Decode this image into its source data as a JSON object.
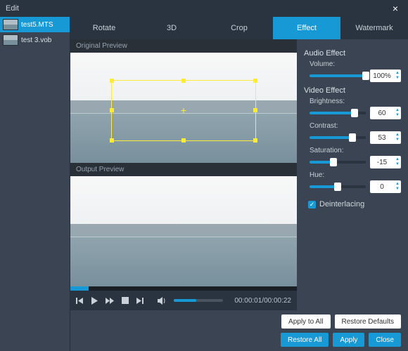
{
  "window": {
    "title": "Edit"
  },
  "files": [
    {
      "name": "test5.MTS",
      "selected": true
    },
    {
      "name": "test 3.vob",
      "selected": false
    }
  ],
  "tabs": {
    "rotate": "Rotate",
    "threeD": "3D",
    "crop": "Crop",
    "effect": "Effect",
    "watermark": "Watermark",
    "active": "effect"
  },
  "preview": {
    "originalLabel": "Original Preview",
    "outputLabel": "Output Preview",
    "time": "00:00:01/00:00:22"
  },
  "panel": {
    "audioHeader": "Audio Effect",
    "volumeLabel": "Volume:",
    "volumeValue": "100%",
    "volumePct": 100,
    "videoHeader": "Video Effect",
    "brightness": {
      "label": "Brightness:",
      "value": "60",
      "pct": 80
    },
    "contrast": {
      "label": "Contrast:",
      "value": "53",
      "pct": 76
    },
    "saturation": {
      "label": "Saturation:",
      "value": "-15",
      "pct": 42
    },
    "hue": {
      "label": "Hue:",
      "value": "0",
      "pct": 50
    },
    "deinterlacing": "Deinterlacing"
  },
  "buttons": {
    "applyAll": "Apply to All",
    "restoreDefaults": "Restore Defaults",
    "restoreAll": "Restore All",
    "apply": "Apply",
    "close": "Close"
  }
}
